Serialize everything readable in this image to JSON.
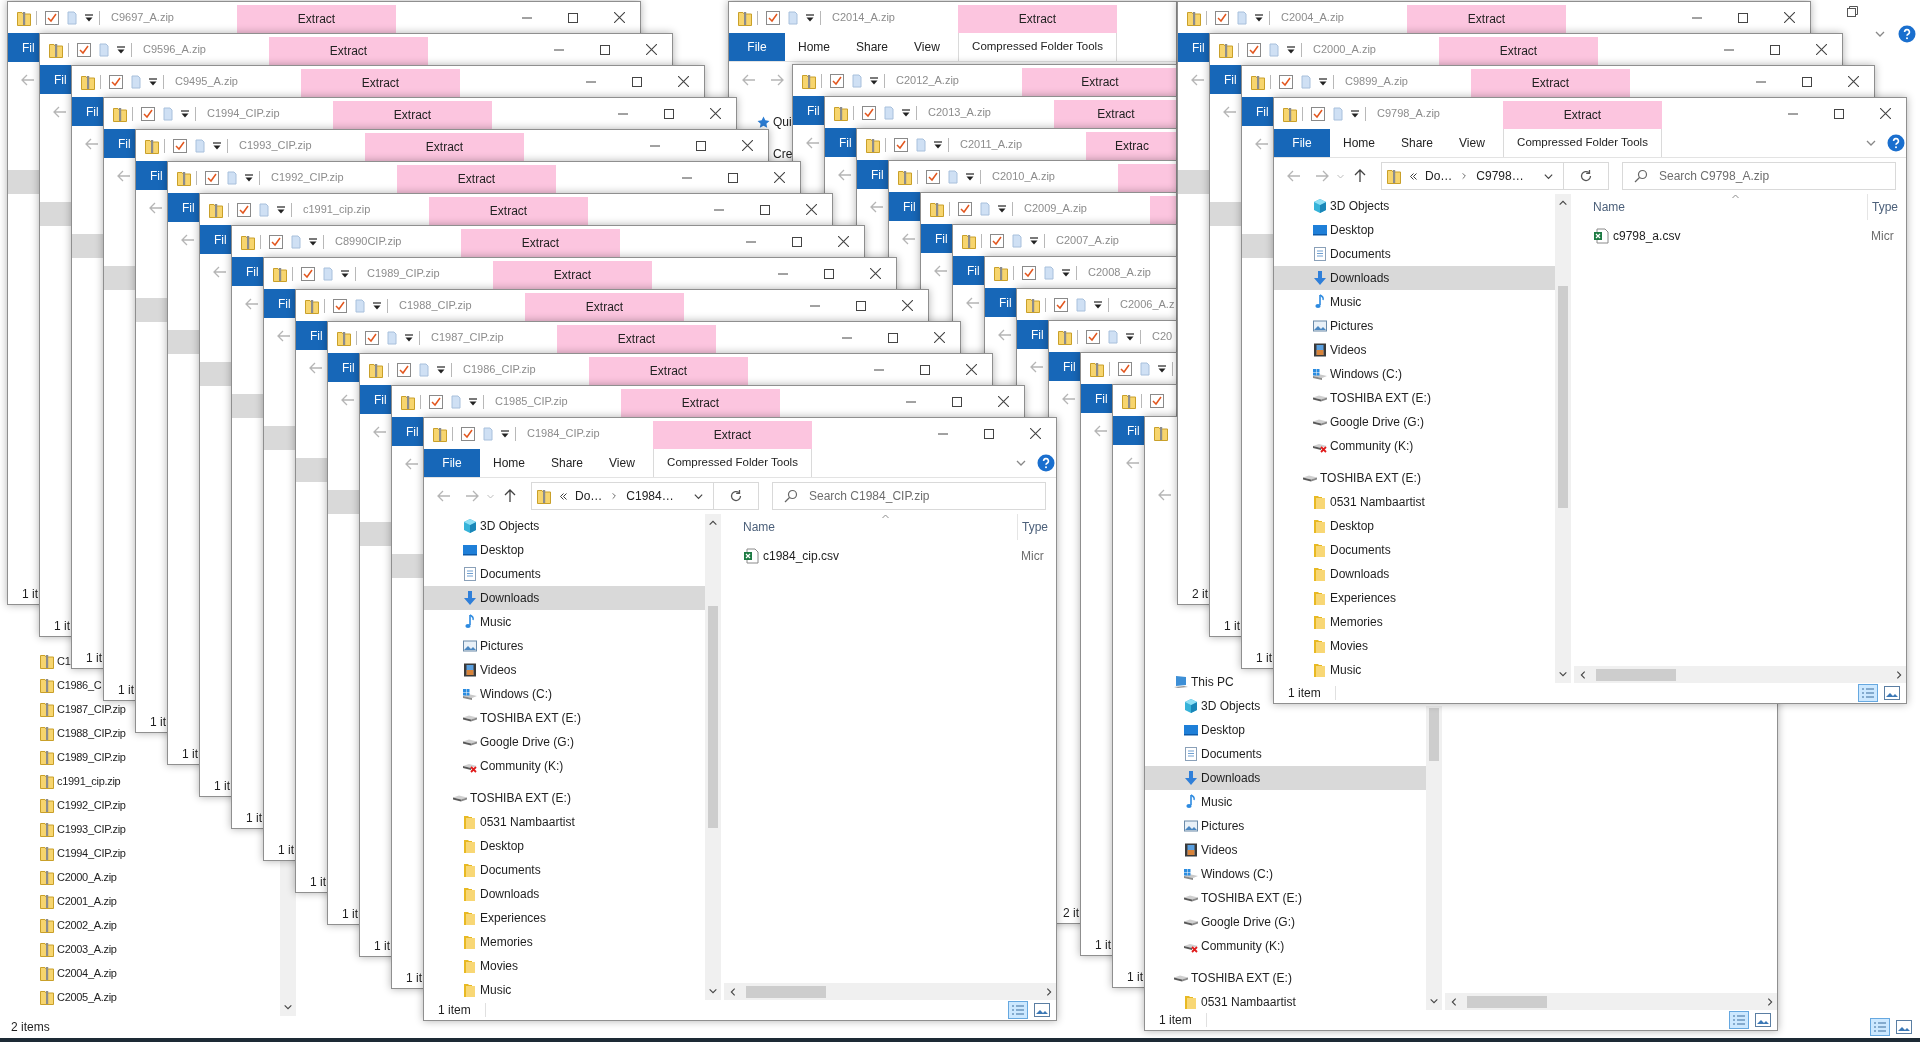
{
  "background_window": {
    "files": [
      "C1",
      "C1986_C",
      "C1987_CIP.zip",
      "C1988_CIP.zip",
      "C1989_CIP.zip",
      "c1991_cip.zip",
      "C1992_CIP.zip",
      "C1993_CIP.zip",
      "C1994_CIP.zip",
      "C2000_A.zip",
      "C2001_A.zip",
      "C2002_A.zip",
      "C2003_A.zip",
      "C2004_A.zip",
      "C2005_A.zip"
    ],
    "status": "2 items"
  },
  "middle_stack": [
    {
      "title": "C2014_A.zip",
      "extract": "Extract",
      "ribbon": {
        "file": "File",
        "tabs": [
          "Home",
          "Share",
          "View"
        ],
        "context": "Compressed Folder Tools"
      },
      "nav_fragments": [
        {
          "label": "Qui",
          "kind": "star"
        },
        {
          "label": "Cre",
          "kind": "plain"
        }
      ]
    },
    {
      "title": "C2012_A.zip",
      "extract": "Extract",
      "file_tab": "Fil"
    },
    {
      "title": "C2013_A.zip",
      "extract": "Extract",
      "file_tab": "Fil"
    },
    {
      "title": "C2011_A.zip",
      "extract": "Extrac",
      "file_tab": "Fil"
    },
    {
      "title": "C2010_A.zip",
      "file_tab": "Fil"
    },
    {
      "title": "C2009_A.zip",
      "file_tab": "Fil"
    },
    {
      "title": "C2007_A.zip",
      "file_tab": "Fil"
    },
    {
      "title": "C2008_A.zip",
      "file_tab": "Fil"
    },
    {
      "title": "C2006_A.z",
      "file_tab": "Fil"
    },
    {
      "title": "C20",
      "file_tab": "Fil",
      "status": "2 it"
    },
    {
      "file_tab": "Fil",
      "status": "1 it"
    },
    {
      "file_tab": "Fil",
      "status": "1 it"
    }
  ],
  "middle_front": {
    "status": "1 item",
    "nav": [
      {
        "label": "This PC",
        "kind": "pc",
        "selected": false,
        "children": [
          {
            "label": "3D Objects",
            "kind": "cube",
            "selected": false
          },
          {
            "label": "Desktop",
            "kind": "desktop",
            "selected": false
          },
          {
            "label": "Documents",
            "kind": "documents",
            "selected": false
          },
          {
            "label": "Downloads",
            "kind": "download",
            "selected": true
          },
          {
            "label": "Music",
            "kind": "music",
            "selected": false
          },
          {
            "label": "Pictures",
            "kind": "pictures",
            "selected": false
          },
          {
            "label": "Videos",
            "kind": "videos",
            "selected": false
          },
          {
            "label": "Windows (C:)",
            "kind": "windows_drive",
            "selected": false
          },
          {
            "label": "TOSHIBA EXT (E:)",
            "kind": "drive",
            "selected": false
          },
          {
            "label": "Google Drive (G:)",
            "kind": "drive",
            "selected": false
          },
          {
            "label": "Community (K:)",
            "kind": "drive_error",
            "selected": false
          }
        ]
      },
      {
        "label": "TOSHIBA EXT (E:)",
        "kind": "drive",
        "selected": false,
        "children": [
          {
            "label": "0531 Nambaartist",
            "kind": "folder",
            "selected": false
          }
        ]
      }
    ]
  },
  "left_stack": [
    {
      "title": "C9697_A.zip",
      "extract": "Extract",
      "file_tab": "Fil",
      "status": "1 it"
    },
    {
      "title": "C9596_A.zip",
      "extract": "Extract",
      "file_tab": "Fil",
      "status": "1 it"
    },
    {
      "title": "C9495_A.zip",
      "extract": "Extract",
      "file_tab": "Fil",
      "status": "1 it"
    },
    {
      "title": "C1994_CIP.zip",
      "extract": "Extract",
      "file_tab": "Fil",
      "status": "1 it"
    },
    {
      "title": "C1993_CIP.zip",
      "extract": "Extract",
      "file_tab": "Fil",
      "status": "1 it"
    },
    {
      "title": "C1992_CIP.zip",
      "extract": "Extract",
      "file_tab": "Fil",
      "status": "1 it"
    },
    {
      "title": "c1991_cip.zip",
      "extract": "Extract",
      "file_tab": "Fil",
      "status": "1 it"
    },
    {
      "title": "C8990CIP.zip",
      "extract": "Extract",
      "file_tab": "Fil",
      "status": "1 it"
    },
    {
      "title": "C1989_CIP.zip",
      "extract": "Extract",
      "file_tab": "Fil",
      "status": "1 it"
    },
    {
      "title": "C1988_CIP.zip",
      "extract": "Extract",
      "file_tab": "Fil",
      "status": "1 it"
    },
    {
      "title": "C1987_CIP.zip",
      "extract": "Extract",
      "file_tab": "Fil",
      "status": "1 it"
    },
    {
      "title": "C1986_CIP.zip",
      "extract": "Extract",
      "file_tab": "Fil",
      "status": "1 it"
    },
    {
      "title": "C1985_CIP.zip",
      "extract": "Extract",
      "file_tab": "Fil",
      "status": "1 it"
    }
  ],
  "left_front": {
    "title": "C1984_CIP.zip",
    "extract": "Extract",
    "ribbon": {
      "file": "File",
      "tabs": [
        "Home",
        "Share",
        "View"
      ],
      "context": "Compressed Folder Tools"
    },
    "address": {
      "parts": [
        "Do…",
        "C1984…"
      ],
      "placeholder": "Search C1984_CIP.zip"
    },
    "nav": [
      {
        "label": "3D Objects",
        "kind": "cube",
        "selected": false
      },
      {
        "label": "Desktop",
        "kind": "desktop",
        "selected": false
      },
      {
        "label": "Documents",
        "kind": "documents",
        "selected": false
      },
      {
        "label": "Downloads",
        "kind": "download",
        "selected": true
      },
      {
        "label": "Music",
        "kind": "music",
        "selected": false
      },
      {
        "label": "Pictures",
        "kind": "pictures",
        "selected": false
      },
      {
        "label": "Videos",
        "kind": "videos",
        "selected": false
      },
      {
        "label": "Windows (C:)",
        "kind": "windows_drive",
        "selected": false
      },
      {
        "label": "TOSHIBA EXT (E:)",
        "kind": "drive",
        "selected": false
      },
      {
        "label": "Google Drive (G:)",
        "kind": "drive",
        "selected": false
      },
      {
        "label": "Community (K:)",
        "kind": "drive_error",
        "selected": false
      },
      {
        "label": "TOSHIBA EXT (E:)",
        "kind": "drive",
        "selected": false,
        "children": [
          {
            "label": "0531 Nambaartist",
            "kind": "folder",
            "selected": false
          },
          {
            "label": "Desktop",
            "kind": "folder",
            "selected": false
          },
          {
            "label": "Documents",
            "kind": "folder",
            "selected": false
          },
          {
            "label": "Downloads",
            "kind": "folder",
            "selected": false
          },
          {
            "label": "Experiences",
            "kind": "folder",
            "selected": false
          },
          {
            "label": "Memories",
            "kind": "folder",
            "selected": false
          },
          {
            "label": "Movies",
            "kind": "folder",
            "selected": false
          },
          {
            "label": "Music",
            "kind": "folder",
            "selected": false
          }
        ]
      }
    ],
    "columns": [
      "Name",
      "Type"
    ],
    "files": [
      {
        "name": "c1984_cip.csv",
        "type": "Micr"
      }
    ],
    "status": "1 item"
  },
  "right_stack": [
    {
      "title": "C2004_A.zip",
      "extract": "Extract",
      "file_tab": "Fil",
      "status": "2 it"
    },
    {
      "title": "C2000_A.zip",
      "extract": "Extract",
      "file_tab": "Fil",
      "status": "1 it"
    },
    {
      "title": "C9899_A.zip",
      "extract": "Extract",
      "file_tab": "Fil",
      "status": "1 it"
    }
  ],
  "right_front": {
    "title": "C9798_A.zip",
    "extract": "Extract",
    "ribbon": {
      "file": "File",
      "tabs": [
        "Home",
        "Share",
        "View"
      ],
      "context": "Compressed Folder Tools"
    },
    "address": {
      "parts": [
        "Do…",
        "C9798…"
      ],
      "placeholder": "Search C9798_A.zip"
    },
    "nav": [
      {
        "label": "3D Objects",
        "kind": "cube",
        "selected": false
      },
      {
        "label": "Desktop",
        "kind": "desktop",
        "selected": false
      },
      {
        "label": "Documents",
        "kind": "documents",
        "selected": false
      },
      {
        "label": "Downloads",
        "kind": "download",
        "selected": true
      },
      {
        "label": "Music",
        "kind": "music",
        "selected": false
      },
      {
        "label": "Pictures",
        "kind": "pictures",
        "selected": false
      },
      {
        "label": "Videos",
        "kind": "videos",
        "selected": false
      },
      {
        "label": "Windows (C:)",
        "kind": "windows_drive",
        "selected": false
      },
      {
        "label": "TOSHIBA EXT (E:)",
        "kind": "drive",
        "selected": false
      },
      {
        "label": "Google Drive (G:)",
        "kind": "drive",
        "selected": false
      },
      {
        "label": "Community (K:)",
        "kind": "drive_error",
        "selected": false
      },
      {
        "label": "TOSHIBA EXT (E:)",
        "kind": "drive",
        "selected": false,
        "children": [
          {
            "label": "0531 Nambaartist",
            "kind": "folder",
            "selected": false
          },
          {
            "label": "Desktop",
            "kind": "folder",
            "selected": false
          },
          {
            "label": "Documents",
            "kind": "folder",
            "selected": false
          },
          {
            "label": "Downloads",
            "kind": "folder",
            "selected": false
          },
          {
            "label": "Experiences",
            "kind": "folder",
            "selected": false
          },
          {
            "label": "Memories",
            "kind": "folder",
            "selected": false
          },
          {
            "label": "Movies",
            "kind": "folder",
            "selected": false
          },
          {
            "label": "Music",
            "kind": "folder",
            "selected": false
          }
        ]
      }
    ],
    "columns": [
      "Name",
      "Type"
    ],
    "files": [
      {
        "name": "c9798_a.csv",
        "type": "Micr"
      }
    ],
    "status": "1 item"
  }
}
